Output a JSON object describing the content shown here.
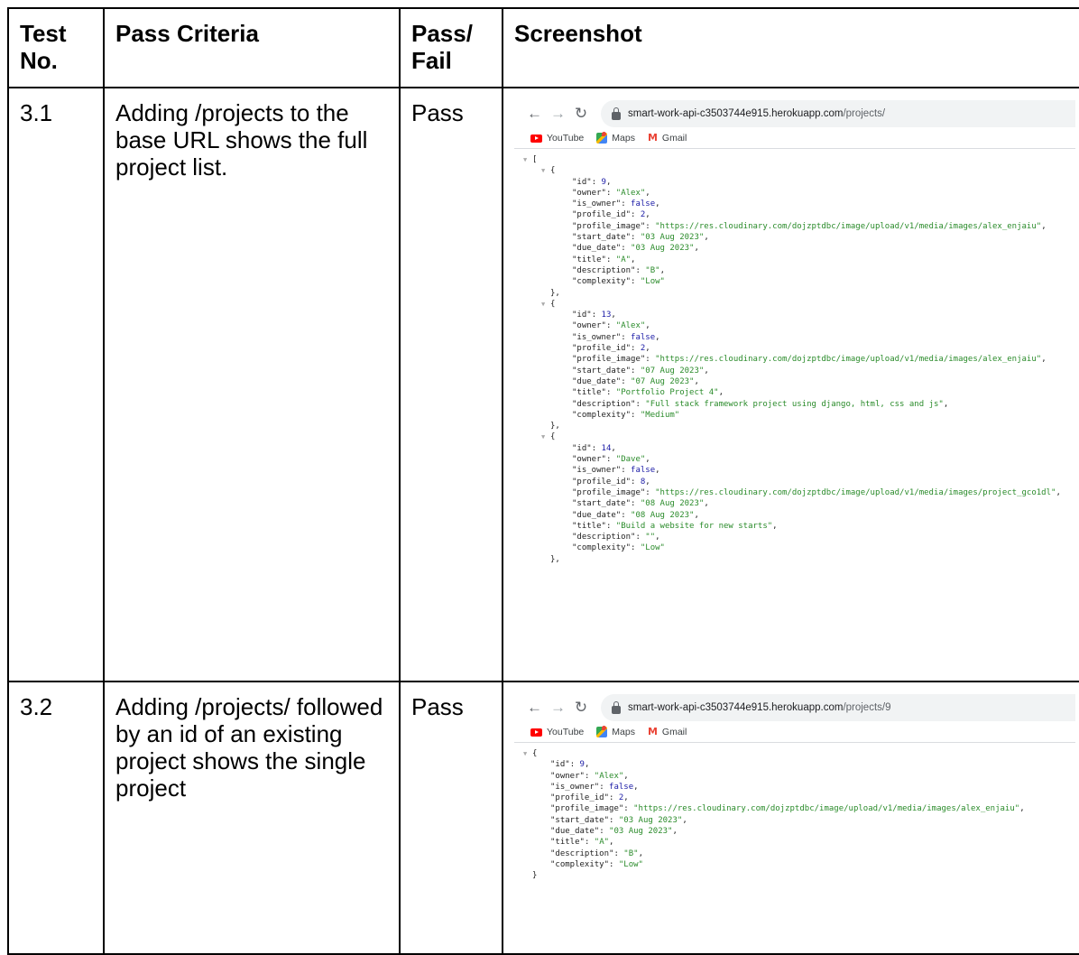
{
  "headers": [
    "Test No.",
    "Pass Criteria",
    "Pass/ Fail",
    "Screenshot"
  ],
  "rows": [
    {
      "test_no": "3.1",
      "criteria": "Adding /projects to the base URL shows the full project list.",
      "result": "Pass",
      "browser": {
        "url_host": "smart-work-api-c3503744e915.herokuapp.com",
        "url_path": "/projects/",
        "bookmarks": [
          "YouTube",
          "Maps",
          "Gmail"
        ]
      }
    },
    {
      "test_no": "3.2",
      "criteria": "Adding /projects/ followed by an id of an existing project shows the single project",
      "result": "Pass",
      "browser": {
        "url_host": "smart-work-api-c3503744e915.herokuapp.com",
        "url_path": "/projects/9",
        "bookmarks": [
          "YouTube",
          "Maps",
          "Gmail"
        ]
      }
    }
  ],
  "icons": {
    "back": "arrow-left-icon",
    "forward": "arrow-right-icon",
    "reload": "reload-icon",
    "lock": "lock-icon"
  },
  "json_list": [
    [
      {
        "key": "id",
        "value": "9",
        "type": "number"
      },
      {
        "key": "owner",
        "value": "\"Alex\"",
        "type": "string"
      },
      {
        "key": "is_owner",
        "value": "false",
        "type": "bool"
      },
      {
        "key": "profile_id",
        "value": "2",
        "type": "number"
      },
      {
        "key": "profile_image",
        "value": "\"https://res.cloudinary.com/dojzptdbc/image/upload/v1/media/images/alex_enjaiu\"",
        "type": "string"
      },
      {
        "key": "start_date",
        "value": "\"03 Aug 2023\"",
        "type": "string"
      },
      {
        "key": "due_date",
        "value": "\"03 Aug 2023\"",
        "type": "string"
      },
      {
        "key": "title",
        "value": "\"A\"",
        "type": "string"
      },
      {
        "key": "description",
        "value": "\"B\"",
        "type": "string"
      },
      {
        "key": "complexity",
        "value": "\"Low\"",
        "type": "string"
      }
    ],
    [
      {
        "key": "id",
        "value": "13",
        "type": "number"
      },
      {
        "key": "owner",
        "value": "\"Alex\"",
        "type": "string"
      },
      {
        "key": "is_owner",
        "value": "false",
        "type": "bool"
      },
      {
        "key": "profile_id",
        "value": "2",
        "type": "number"
      },
      {
        "key": "profile_image",
        "value": "\"https://res.cloudinary.com/dojzptdbc/image/upload/v1/media/images/alex_enjaiu\"",
        "type": "string"
      },
      {
        "key": "start_date",
        "value": "\"07 Aug 2023\"",
        "type": "string"
      },
      {
        "key": "due_date",
        "value": "\"07 Aug 2023\"",
        "type": "string"
      },
      {
        "key": "title",
        "value": "\"Portfolio Project 4\"",
        "type": "string"
      },
      {
        "key": "description",
        "value": "\"Full stack framework project using django, html, css and js\"",
        "type": "string"
      },
      {
        "key": "complexity",
        "value": "\"Medium\"",
        "type": "string"
      }
    ],
    [
      {
        "key": "id",
        "value": "14",
        "type": "number"
      },
      {
        "key": "owner",
        "value": "\"Dave\"",
        "type": "string"
      },
      {
        "key": "is_owner",
        "value": "false",
        "type": "bool"
      },
      {
        "key": "profile_id",
        "value": "8",
        "type": "number"
      },
      {
        "key": "profile_image",
        "value": "\"https://res.cloudinary.com/dojzptdbc/image/upload/v1/media/images/project_gco1dl\"",
        "type": "string"
      },
      {
        "key": "start_date",
        "value": "\"08 Aug 2023\"",
        "type": "string"
      },
      {
        "key": "due_date",
        "value": "\"08 Aug 2023\"",
        "type": "string"
      },
      {
        "key": "title",
        "value": "\"Build a website for new starts\"",
        "type": "string"
      },
      {
        "key": "description",
        "value": "\"\"",
        "type": "string"
      },
      {
        "key": "complexity",
        "value": "\"Low\"",
        "type": "string"
      }
    ]
  ],
  "json_single": [
    {
      "key": "id",
      "value": "9",
      "type": "number"
    },
    {
      "key": "owner",
      "value": "\"Alex\"",
      "type": "string"
    },
    {
      "key": "is_owner",
      "value": "false",
      "type": "bool"
    },
    {
      "key": "profile_id",
      "value": "2",
      "type": "number"
    },
    {
      "key": "profile_image",
      "value": "\"https://res.cloudinary.com/dojzptdbc/image/upload/v1/media/images/alex_enjaiu\"",
      "type": "string"
    },
    {
      "key": "start_date",
      "value": "\"03 Aug 2023\"",
      "type": "string"
    },
    {
      "key": "due_date",
      "value": "\"03 Aug 2023\"",
      "type": "string"
    },
    {
      "key": "title",
      "value": "\"A\"",
      "type": "string"
    },
    {
      "key": "description",
      "value": "\"B\"",
      "type": "string"
    },
    {
      "key": "complexity",
      "value": "\"Low\"",
      "type": "string"
    }
  ]
}
